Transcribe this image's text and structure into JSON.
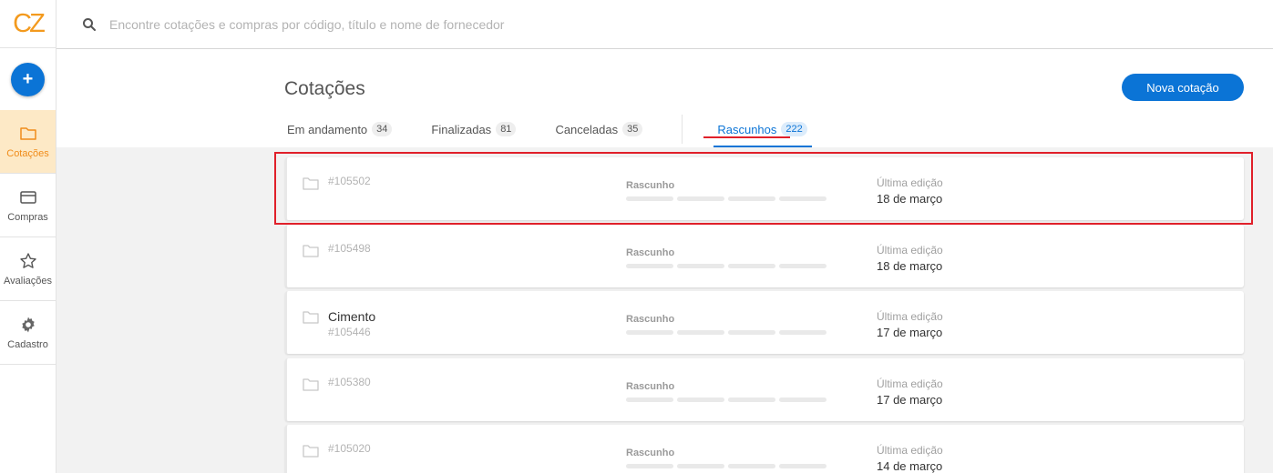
{
  "logo": "CZ",
  "sidebar": {
    "add_label": "+",
    "items": [
      {
        "label": "Cotações",
        "icon": "folder-icon",
        "active": true
      },
      {
        "label": "Compras",
        "icon": "card-icon",
        "active": false
      },
      {
        "label": "Avaliações",
        "icon": "star-icon",
        "active": false
      },
      {
        "label": "Cadastro",
        "icon": "gear-icon",
        "active": false
      }
    ]
  },
  "search": {
    "placeholder": "Encontre cotações e compras por código, título e nome de fornecedor",
    "value": ""
  },
  "header": {
    "title": "Cotações",
    "new_button": "Nova cotação"
  },
  "tabs": [
    {
      "label": "Em andamento",
      "count": "34"
    },
    {
      "label": "Finalizadas",
      "count": "81"
    },
    {
      "label": "Canceladas",
      "count": "35"
    },
    {
      "label": "Rascunhos",
      "count": "222",
      "active": true
    }
  ],
  "rows": [
    {
      "title": "",
      "code": "#105502",
      "status": "Rascunho",
      "edit_label": "Última edição",
      "edit_date": "18 de março"
    },
    {
      "title": "",
      "code": "#105498",
      "status": "Rascunho",
      "edit_label": "Última edição",
      "edit_date": "18 de março"
    },
    {
      "title": "Cimento",
      "code": "#105446",
      "status": "Rascunho",
      "edit_label": "Última edição",
      "edit_date": "17 de março"
    },
    {
      "title": "",
      "code": "#105380",
      "status": "Rascunho",
      "edit_label": "Última edição",
      "edit_date": "17 de março"
    },
    {
      "title": "",
      "code": "#105020",
      "status": "Rascunho",
      "edit_label": "Última edição",
      "edit_date": "14 de março"
    }
  ],
  "colors": {
    "accent": "#0b74d6",
    "brand": "#f39a1e",
    "highlight": "#e0202a",
    "active_nav_bg": "#fde9c6"
  }
}
